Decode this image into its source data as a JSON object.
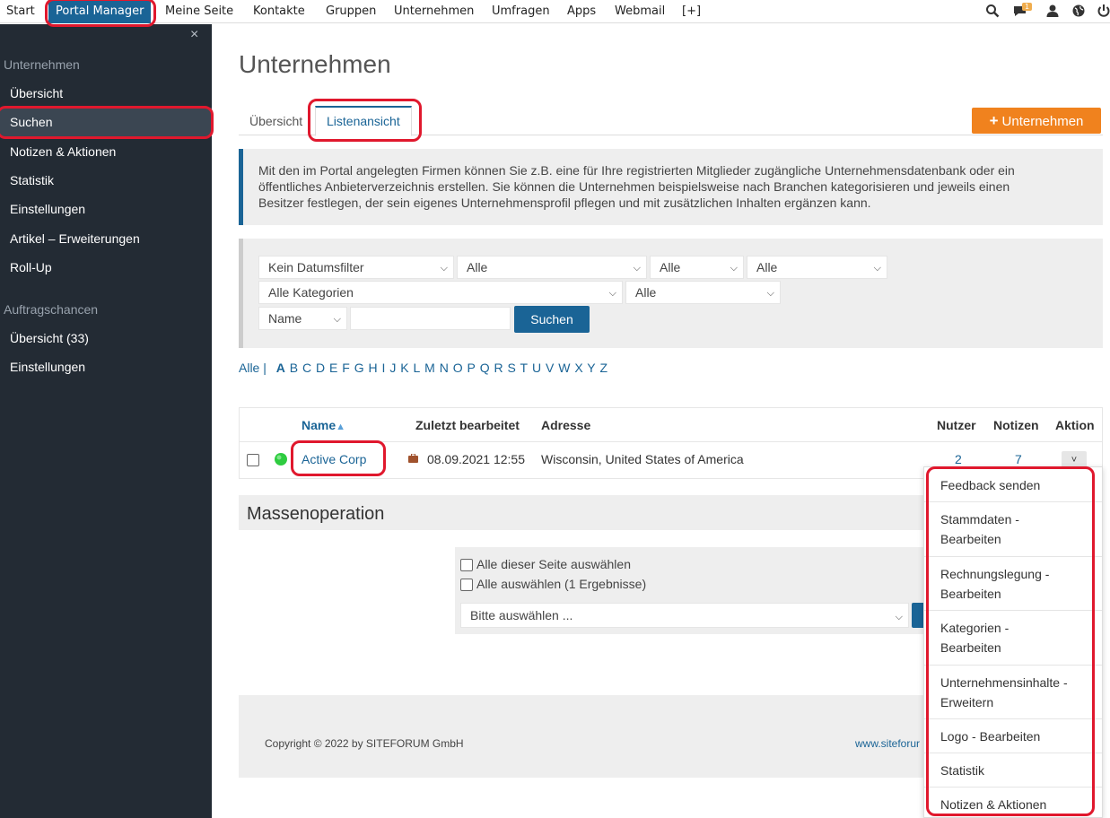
{
  "topnav": {
    "items": [
      "Start",
      "Portal Manager",
      "Meine Seite",
      "Kontakte",
      "Gruppen",
      "Unternehmen",
      "Umfragen",
      "Apps",
      "Webmail",
      "[+]"
    ],
    "badge_count": "1",
    "icons": [
      "search-icon",
      "chat-icon",
      "user-icon",
      "globe-icon",
      "power-icon"
    ]
  },
  "sidebar": {
    "close": "×",
    "section1": "Unternehmen",
    "items1": [
      "Übersicht",
      "Suchen",
      "Notizen & Aktionen",
      "Statistik",
      "Einstellungen",
      "Artikel – Erweiterungen",
      "Roll-Up"
    ],
    "section2": "Auftragschancen",
    "items2": [
      "Übersicht (33)",
      "Einstellungen"
    ]
  },
  "page": {
    "title": "Unternehmen",
    "tabs": [
      "Übersicht",
      "Listenansicht"
    ],
    "add_button": "Unternehmen",
    "info_text": "Mit den im Portal angelegten Firmen können Sie z.B. eine für Ihre registrierten Mitglieder zugängliche Unternehmensdatenbank oder ein öffentliches Anbieterverzeichnis erstellen. Sie können die Unternehmen beispielsweise nach Branchen kategorisieren und jeweils einen Besitzer festlegen, der sein eigenes Unternehmensprofil pflegen und mit zusätzlichen Inhalten ergänzen kann."
  },
  "filters": {
    "date_filter": "Kein Datumsfilter",
    "f2": "Alle",
    "f3": "Alle",
    "f4": "Alle",
    "categories": "Alle Kategorien",
    "f6": "Alle",
    "field": "Name",
    "search_value": "",
    "search_button": "Suchen"
  },
  "alphabet": {
    "all": "Alle |",
    "letters": [
      "A",
      "B",
      "C",
      "D",
      "E",
      "F",
      "G",
      "H",
      "I",
      "J",
      "K",
      "L",
      "M",
      "N",
      "O",
      "P",
      "Q",
      "R",
      "S",
      "T",
      "U",
      "V",
      "W",
      "X",
      "Y",
      "Z"
    ]
  },
  "table": {
    "headers": [
      "Name",
      "Zuletzt bearbeitet",
      "Adresse",
      "Nutzer",
      "Notizen",
      "Aktion"
    ],
    "rows": [
      {
        "name": "Active Corp",
        "edited": "08.09.2021 12:55",
        "address": "Wisconsin, United States of America",
        "users": "2",
        "notes": "7"
      }
    ]
  },
  "mass": {
    "title": "Massenoperation",
    "select_page": "Alle dieser Seite auswählen",
    "select_all": "Alle auswählen (1 Ergebnisse)",
    "select_placeholder": "Bitte auswählen ..."
  },
  "footer": {
    "copyright": "Copyright © 2022 by SITEFORUM GmbH",
    "site": "www.siteforur"
  },
  "action_menu": {
    "items": [
      [
        "Feedback senden"
      ],
      [
        "Stammdaten -",
        "Bearbeiten"
      ],
      [
        "Rechnungslegung -",
        "Bearbeiten"
      ],
      [
        "Kategorien -",
        "Bearbeiten"
      ],
      [
        "Unternehmensinhalte -",
        "Erweitern"
      ],
      [
        "Logo - Bearbeiten"
      ],
      [
        "Statistik"
      ],
      [
        "Notizen & Aktionen"
      ]
    ]
  },
  "colors": {
    "primary": "#1a6496",
    "sidebar": "#232b34",
    "accent": "#f0821e",
    "highlight": "#e0182d",
    "status": "#2ecc40"
  }
}
